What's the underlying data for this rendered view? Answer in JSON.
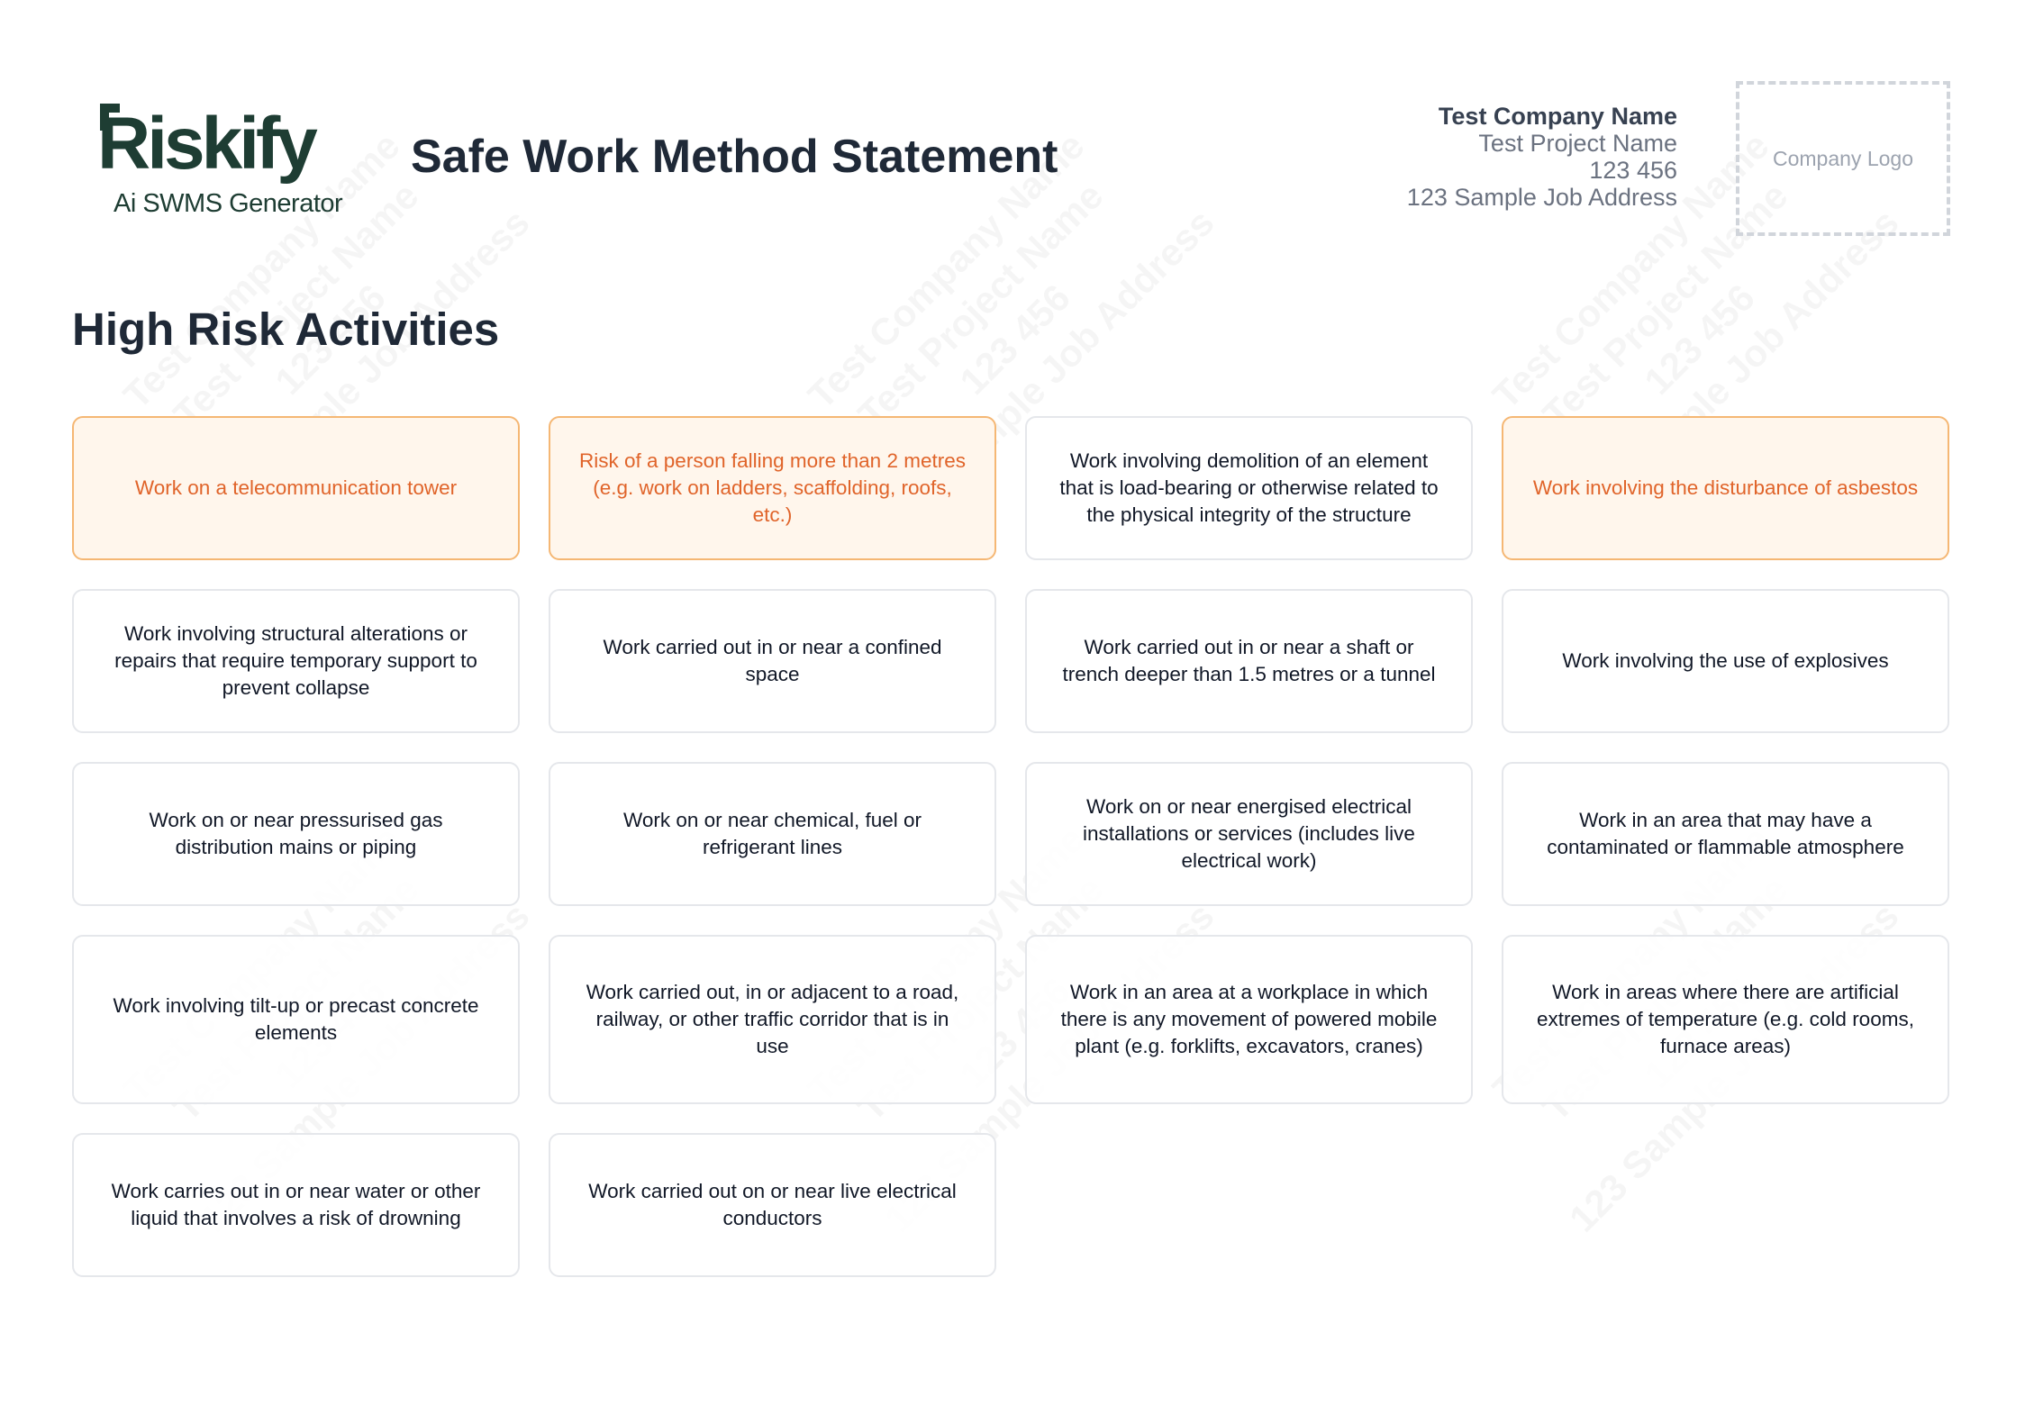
{
  "brand": {
    "name": "Riskify",
    "tagline": "Ai SWMS Generator",
    "color": "#1e3d33"
  },
  "document": {
    "title": "Safe Work Method Statement"
  },
  "company": {
    "name": "Test Company Name",
    "project": "Test Project Name",
    "number": "123 456",
    "address": "123 Sample Job Address",
    "logo_placeholder": "Company Logo"
  },
  "watermark": {
    "lines": [
      "Test Company Name",
      "Test Project Name",
      "123 456",
      "123 Sample Job Address"
    ]
  },
  "section": {
    "title": "High Risk Activities"
  },
  "colors": {
    "highlight_bg": "#fff6ec",
    "highlight_border": "#f5b774",
    "highlight_text": "#e0642a",
    "card_border": "#e5e7eb"
  },
  "activities": [
    {
      "label": "Work on a telecommunication tower",
      "selected": true
    },
    {
      "label": "Risk of a person falling more than 2 metres (e.g. work on ladders, scaffolding, roofs, etc.)",
      "selected": true
    },
    {
      "label": "Work involving demolition of an element that is load-bearing or otherwise related to the physical integrity of the structure",
      "selected": false
    },
    {
      "label": "Work involving the disturbance of asbestos",
      "selected": true
    },
    {
      "label": "Work involving structural alterations or repairs that require temporary support to prevent collapse",
      "selected": false
    },
    {
      "label": "Work carried out in or near a confined space",
      "selected": false
    },
    {
      "label": "Work carried out in or near a shaft or trench deeper than 1.5 metres or a tunnel",
      "selected": false
    },
    {
      "label": "Work involving the use of explosives",
      "selected": false
    },
    {
      "label": "Work on or near pressurised gas distribution mains or piping",
      "selected": false
    },
    {
      "label": "Work on or near chemical, fuel or refrigerant lines",
      "selected": false
    },
    {
      "label": "Work on or near energised electrical installations or services (includes live electrical work)",
      "selected": false
    },
    {
      "label": "Work in an area that may have a contaminated or flammable atmosphere",
      "selected": false
    },
    {
      "label": "Work involving tilt-up or precast concrete elements",
      "selected": false
    },
    {
      "label": "Work carried out, in or adjacent to a road, railway, or other traffic corridor that is in use",
      "selected": false
    },
    {
      "label": "Work in an area at a workplace in which there is any movement of powered mobile plant (e.g. forklifts, excavators, cranes)",
      "selected": false
    },
    {
      "label": "Work in areas where there are artificial extremes of temperature (e.g. cold rooms, furnace areas)",
      "selected": false
    },
    {
      "label": "Work carries out in or near water or other liquid that involves a risk of drowning",
      "selected": false
    },
    {
      "label": "Work carried out on or near live electrical conductors",
      "selected": false
    }
  ]
}
